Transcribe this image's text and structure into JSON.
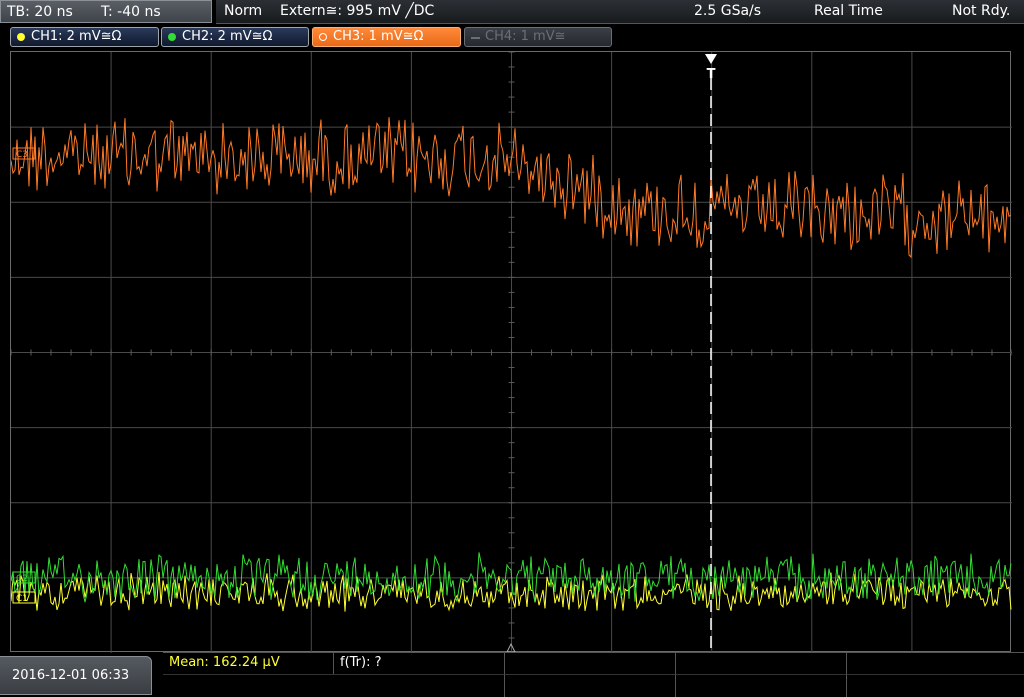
{
  "topbar": {
    "timebase": "TB: 20 ns",
    "trigger_time": "T: -40 ns",
    "trigger_mode": "Norm",
    "trigger_source": "Extern≅: 995 mV ╱DC",
    "sample_rate": "2.5 GSa/s",
    "acq_mode": "Real Time",
    "status": "Not Rdy."
  },
  "channels": [
    {
      "label": "CH1: 2 mV≅Ω",
      "color": "#ffff33",
      "state": "on"
    },
    {
      "label": "CH2: 2 mV≅Ω",
      "color": "#33dd33",
      "state": "on"
    },
    {
      "label": "CH3: 1 mV≅Ω",
      "color": "#ff7a28",
      "state": "active"
    },
    {
      "label": "CH4: 1 mV≅",
      "color": "#6a6f75",
      "state": "off"
    }
  ],
  "markers": {
    "trigger_label": "T",
    "ch3_marker": "C3",
    "ch2_marker": "C2",
    "ch1_marker": "C1"
  },
  "waveforms": {
    "ch3_color": "#ff7a28",
    "ch2_color": "#33dd33",
    "ch1_color": "#ffff33"
  },
  "footer": {
    "datetime": "2016-12-01 06:33",
    "mean": "Mean: 162.24 µV",
    "freq": "f(Tr): ?"
  }
}
